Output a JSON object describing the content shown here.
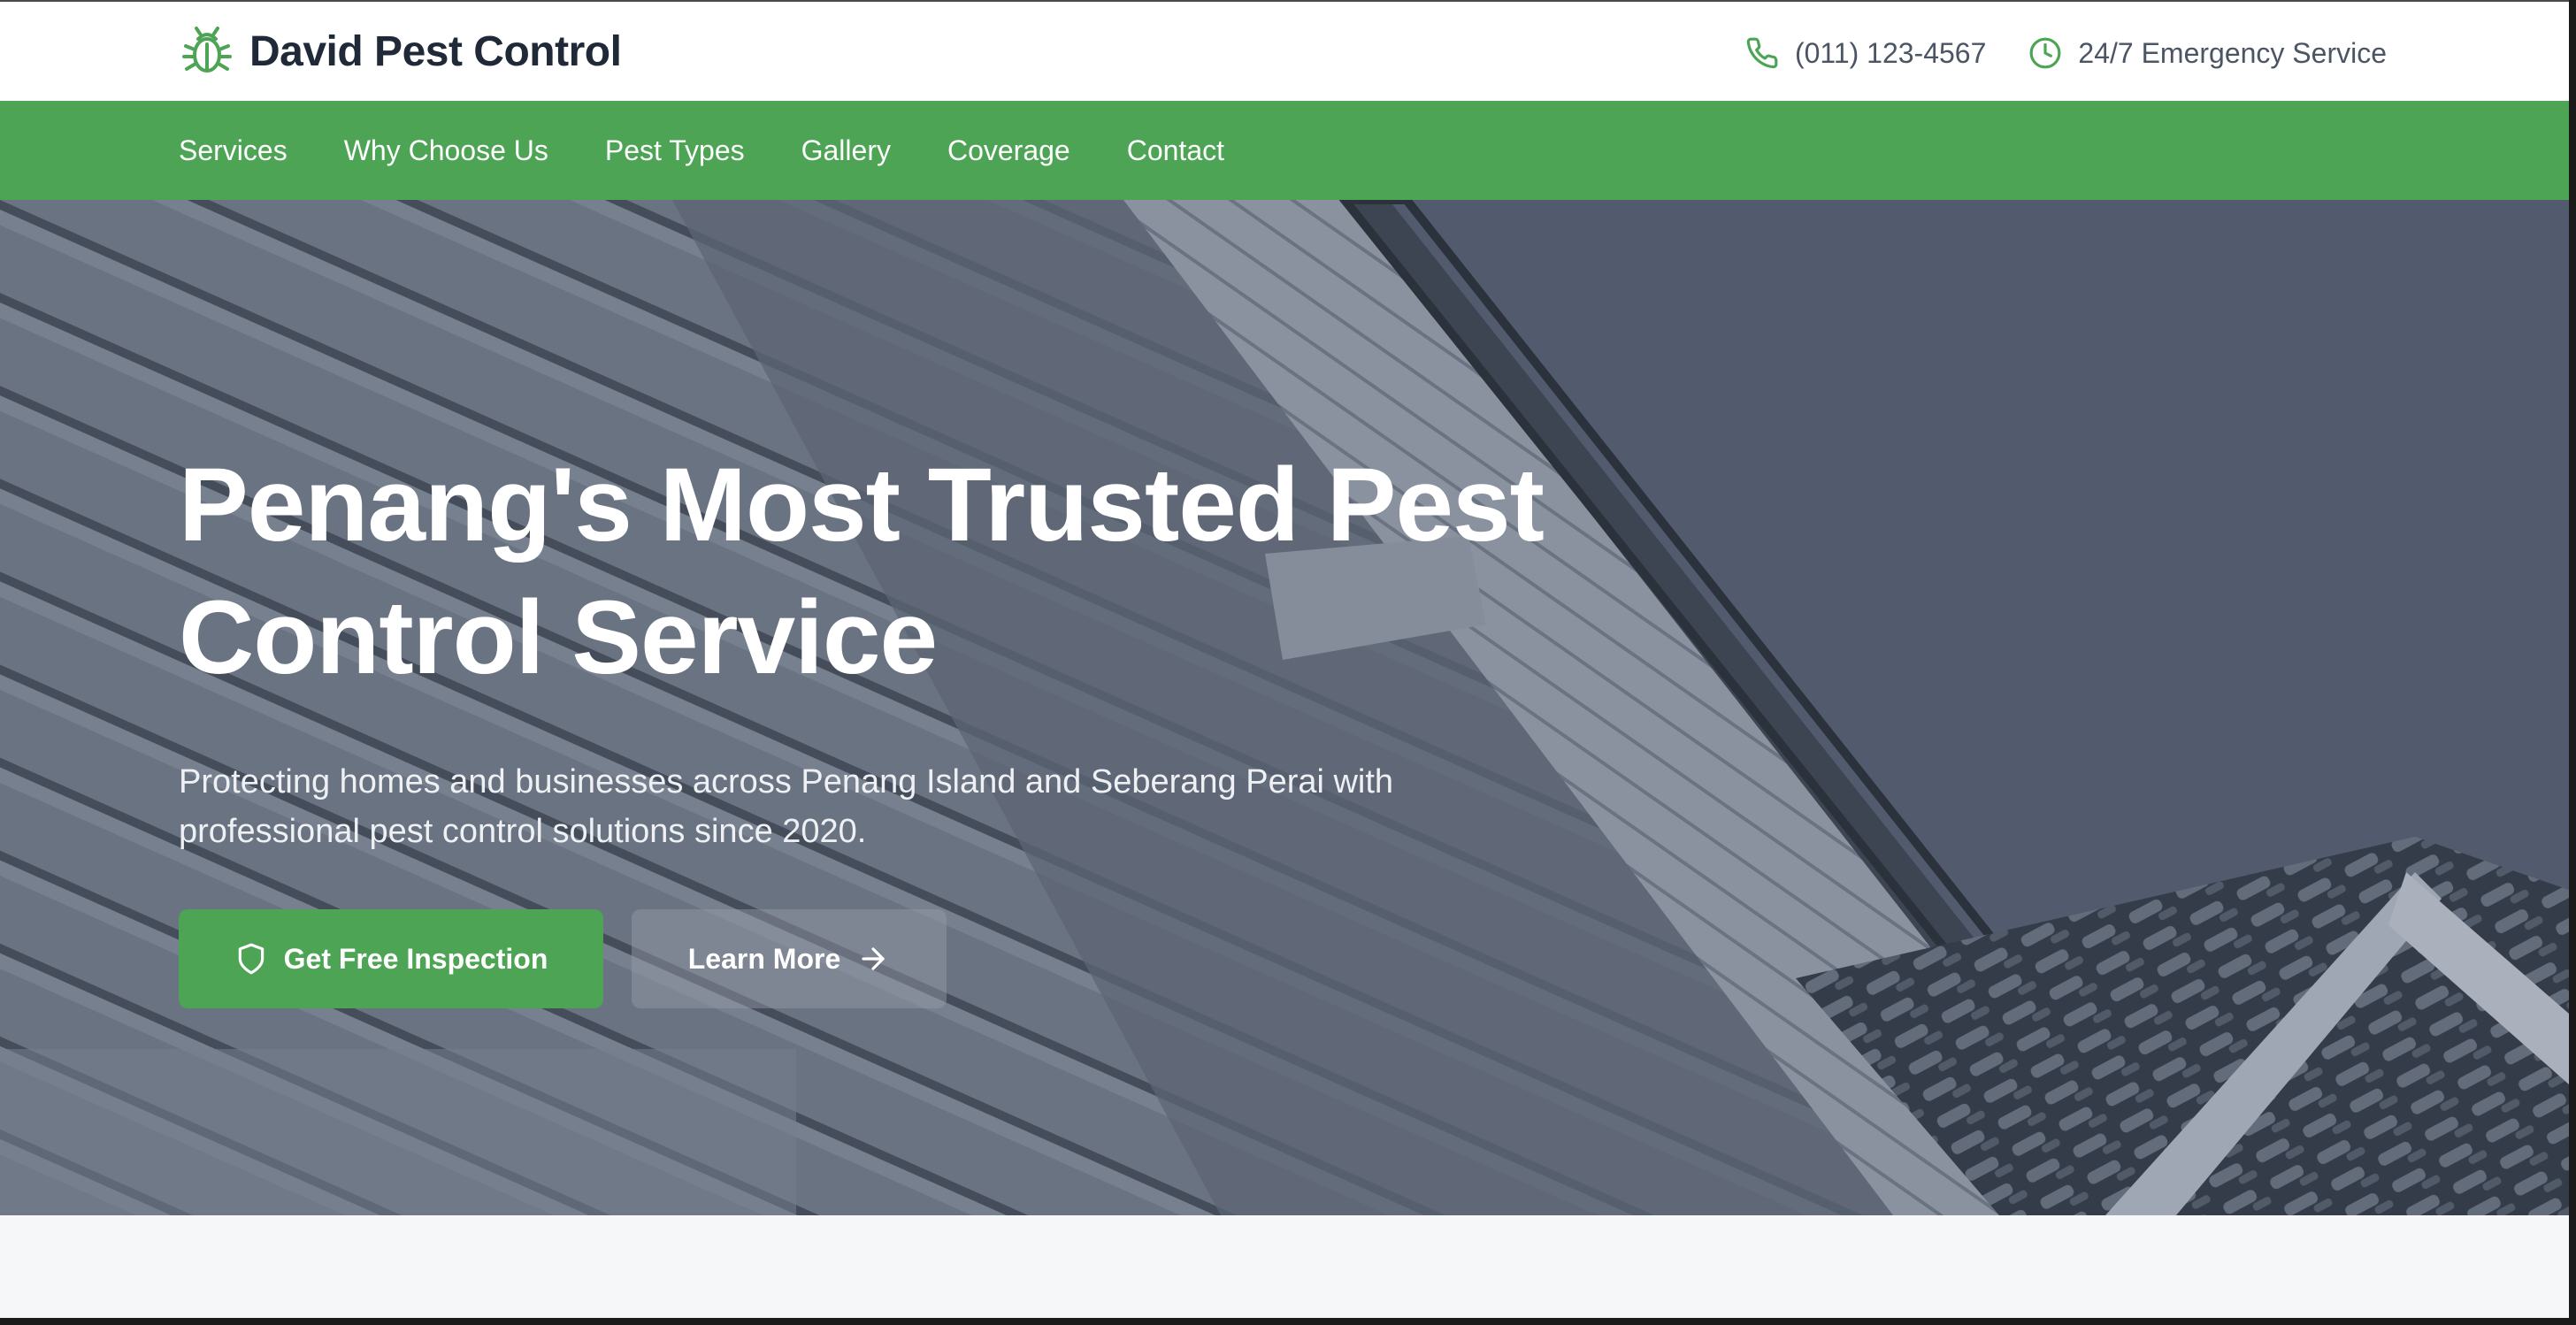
{
  "brand": {
    "name": "David Pest Control",
    "icon": "bug-icon",
    "accent_color": "#4ca454"
  },
  "contact": {
    "phone": "(011) 123-4567",
    "phone_icon": "phone-icon",
    "hours": "24/7 Emergency Service",
    "hours_icon": "clock-icon"
  },
  "nav": {
    "items": [
      {
        "label": "Services"
      },
      {
        "label": "Why Choose Us"
      },
      {
        "label": "Pest Types"
      },
      {
        "label": "Gallery"
      },
      {
        "label": "Coverage"
      },
      {
        "label": "Contact"
      }
    ]
  },
  "hero": {
    "title": "Penang's Most Trusted Pest Control Service",
    "subtitle": "Protecting homes and businesses across Penang Island and Seberang Perai with professional pest control solutions since 2020.",
    "primary_button": {
      "label": "Get Free Inspection",
      "icon": "shield-icon"
    },
    "secondary_button": {
      "label": "Learn More",
      "icon": "arrow-right-icon"
    },
    "background": "house roof photo"
  }
}
